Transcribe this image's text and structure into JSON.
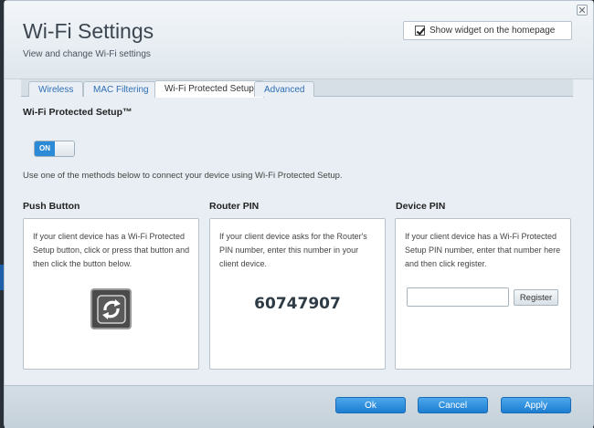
{
  "header": {
    "title": "Wi-Fi Settings",
    "subtitle": "View and change Wi-Fi settings",
    "widget_checkbox_label": "Show widget on the homepage",
    "widget_checked": true
  },
  "window": {
    "close_glyph": "✕"
  },
  "tabs": [
    {
      "label": "Wireless",
      "active": false
    },
    {
      "label": "MAC Filtering",
      "active": false
    },
    {
      "label": "Wi-Fi Protected Setup",
      "active": true
    },
    {
      "label": "Advanced",
      "active": false
    }
  ],
  "wps": {
    "section_title": "Wi-Fi Protected Setup™",
    "toggle_label": "ON",
    "toggle_state": true,
    "instructions": "Use one of the methods below to connect your device using Wi-Fi Protected Setup."
  },
  "panels": {
    "push_button": {
      "heading": "Push Button",
      "text": "If your client device has a Wi-Fi Protected Setup button, click or press that button and then click the button below.",
      "icon": "wps-icon"
    },
    "router_pin": {
      "heading": "Router PIN",
      "text": "If your client device asks for the Router's PIN number, enter this number in your client device.",
      "pin": "60747907"
    },
    "device_pin": {
      "heading": "Device PIN",
      "text": "If your client device has a Wi-Fi Protected Setup PIN number, enter that number here and then click register.",
      "input_value": "",
      "input_placeholder": "",
      "register_label": "Register"
    }
  },
  "footer": {
    "ok_label": "Ok",
    "cancel_label": "Cancel",
    "apply_label": "Apply"
  },
  "colors": {
    "accent": "#2d8ad6",
    "tab_text": "#2f6eb5"
  }
}
